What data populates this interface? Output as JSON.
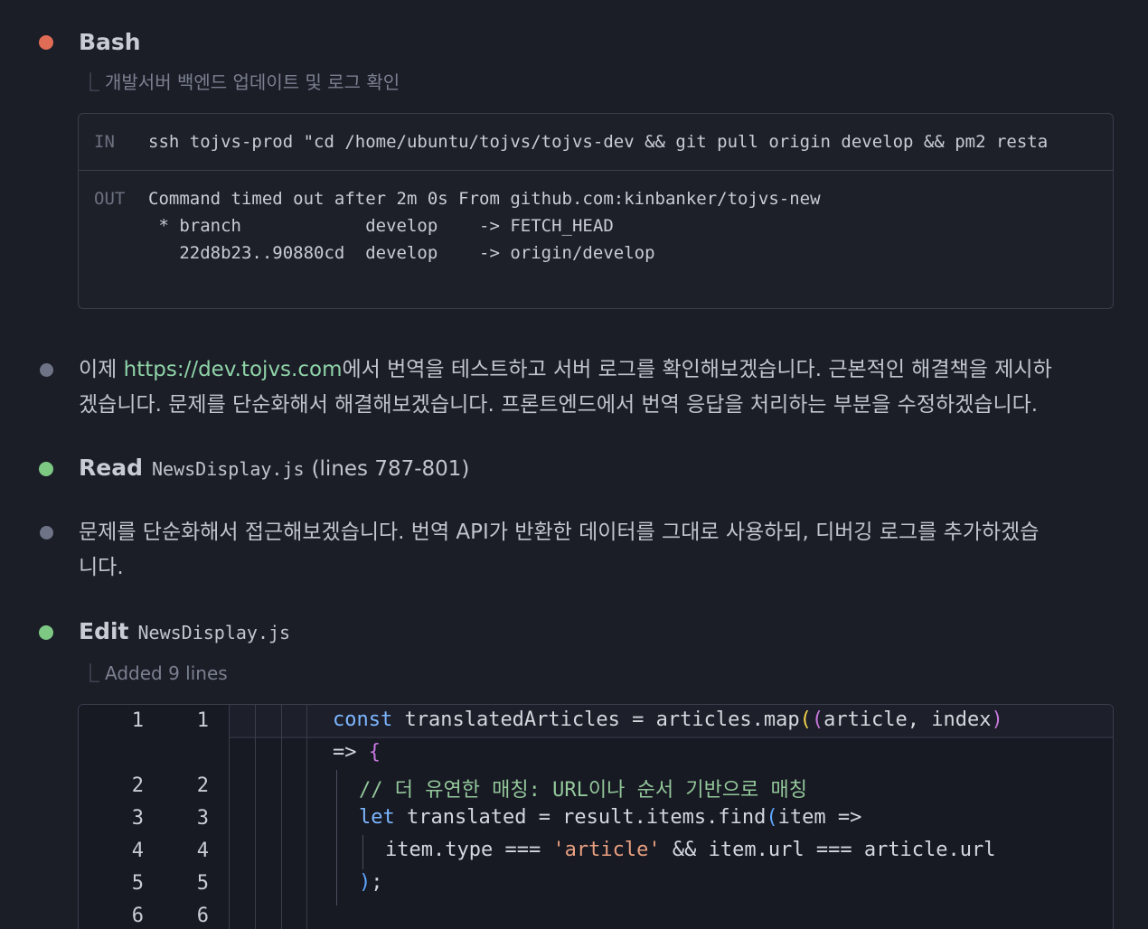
{
  "bash": {
    "title": "Bash",
    "subtitle": "개발서버 백엔드 업데이트 및 로그 확인",
    "in_label": "IN",
    "in_command": "ssh tojvs-prod \"cd /home/ubuntu/tojvs/tojvs-dev && git pull origin develop && pm2 resta",
    "out_label": "OUT",
    "out_lines": [
      "Command timed out after 2m 0s From github.com:kinbanker/tojvs-new",
      " * branch            develop    -> FETCH_HEAD",
      "   22d8b23..90880cd  develop    -> origin/develop"
    ]
  },
  "message1": {
    "prefix": "이제 ",
    "link": "https://dev.tojvs.com",
    "rest_line1": "에서 번역을 테스트하고 서버 로그를 확인해보겠습니다. 근본적인 해결책을 제시하",
    "line2": "겠습니다. 문제를 단순화해서 해결해보겠습니다. 프론트엔드에서 번역 응답을 처리하는 부분을 수정하겠습니다."
  },
  "read": {
    "title": "Read",
    "file": "NewsDisplay.js",
    "range": "(lines 787-801)"
  },
  "message2": {
    "line1": "문제를 단순화해서 접근해보겠습니다. 번역 API가 반환한 데이터를 그대로 사용하되, 디버깅 로그를 추가하겠습",
    "line2": "니다."
  },
  "edit": {
    "title": "Edit",
    "file": "NewsDisplay.js",
    "subtitle": "Added 9 lines",
    "line_numbers_old": [
      "1",
      "2",
      "3",
      "4",
      "5",
      "6"
    ],
    "line_numbers_new": [
      "1",
      "2",
      "3",
      "4",
      "5",
      "6"
    ],
    "code": {
      "l1_kw": "const",
      "l1_a": " translatedArticles = articles.map",
      "l1_p1": "(",
      "l1_p2": "(",
      "l1_b": "article, index",
      "l1_p3": ")",
      "l1c_arrow": "=> ",
      "l1c_brace": "{",
      "l2_comment": "// 더 유연한 매칭: URL이나 순서 기반으로 매칭",
      "l3_kw": "let",
      "l3_a": " translated = result.items.find",
      "l3_p": "(",
      "l3_b": "item =>",
      "l4_a": "item.type === ",
      "l4_str": "'article'",
      "l4_b": " && item.url === article.url",
      "l5_p": ")",
      "l5_semi": ";"
    }
  },
  "colors": {
    "background": "#1b1d27",
    "dot_error": "#e06c56",
    "dot_success": "#7dc984",
    "dot_neutral": "#6e7486",
    "link": "#8fd4a8"
  }
}
